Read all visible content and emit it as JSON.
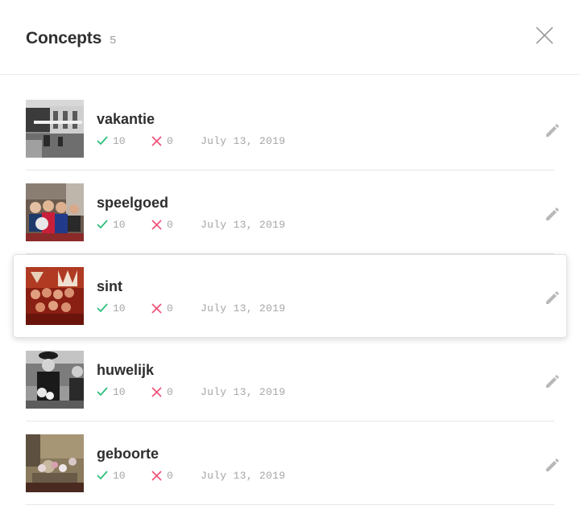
{
  "header": {
    "title": "Concepts",
    "count": "5",
    "close_icon": "close-icon"
  },
  "colors": {
    "check": "#2dbf7c",
    "cross": "#f0547a",
    "muted": "#a6a6a6"
  },
  "concepts": [
    {
      "name": "vakantie",
      "positive": "10",
      "negative": "0",
      "date": "July 13, 2019",
      "thumb": "boardwalk-photo",
      "highlighted": false
    },
    {
      "name": "speelgoed",
      "positive": "10",
      "negative": "0",
      "date": "July 13, 2019",
      "thumb": "children-photo",
      "highlighted": false
    },
    {
      "name": "sint",
      "positive": "10",
      "negative": "0",
      "date": "July 13, 2019",
      "thumb": "red-costume-photo",
      "highlighted": true
    },
    {
      "name": "huwelijk",
      "positive": "10",
      "negative": "0",
      "date": "July 13, 2019",
      "thumb": "wedding-bw-photo",
      "highlighted": false
    },
    {
      "name": "geboorte",
      "positive": "10",
      "negative": "0",
      "date": "July 13, 2019",
      "thumb": "flowers-photo",
      "highlighted": false
    }
  ]
}
